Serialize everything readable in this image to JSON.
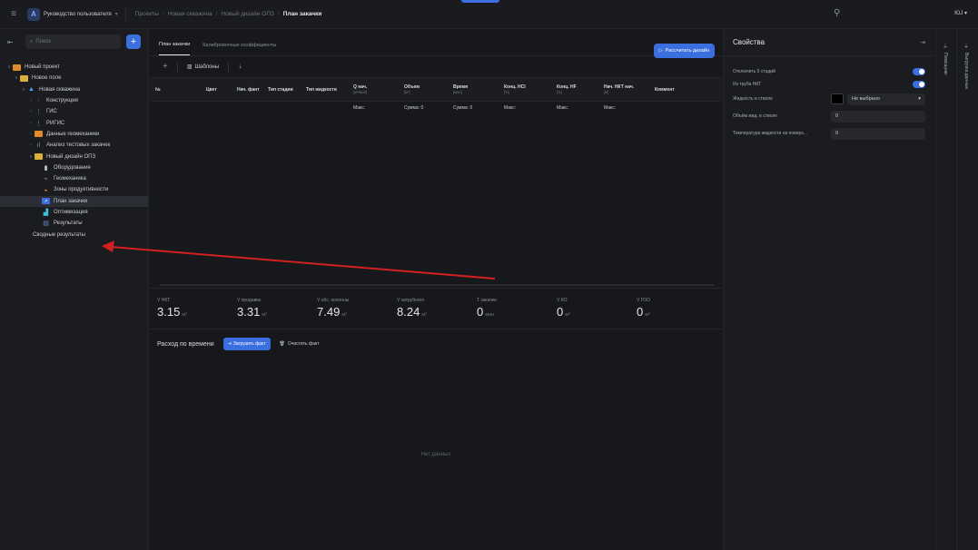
{
  "topbar": {
    "menu_icon": "menu-icon",
    "guide_logo": "A",
    "guide_label": "Руководство пользователя",
    "breadcrumbs": [
      "Проекты",
      "Новая скважина",
      "Новый дизайн ОПЗ",
      "План закачки"
    ],
    "user": "ЮJ"
  },
  "sidebar": {
    "search_placeholder": "Поиск",
    "tree": [
      {
        "label": "Новый проект",
        "level": 0,
        "icon": "project-icon"
      },
      {
        "label": "Новое поле",
        "level": 1,
        "icon": "folder-icon"
      },
      {
        "label": "Новая скважина",
        "level": 2,
        "icon": "well-icon"
      },
      {
        "label": "Конструкция",
        "level": 3,
        "icon": "construction-icon"
      },
      {
        "label": "ГИС",
        "level": 3,
        "icon": "gis-icon"
      },
      {
        "label": "РИГИС",
        "level": 3,
        "icon": "rigis-icon"
      },
      {
        "label": "Данные геомеханики",
        "level": 3,
        "icon": "geomech-folder-icon"
      },
      {
        "label": "Анализ тестовых закачек",
        "level": 3,
        "icon": "analysis-icon"
      },
      {
        "label": "Новый дизайн ОПЗ",
        "level": 3,
        "icon": "design-icon"
      },
      {
        "label": "Оборудование",
        "level": 4,
        "icon": "equipment-icon"
      },
      {
        "label": "Геомеханика",
        "level": 4,
        "icon": "geomechanics-icon"
      },
      {
        "label": "Зоны продуктивности",
        "level": 4,
        "icon": "zones-icon"
      },
      {
        "label": "План закачки",
        "level": 4,
        "icon": "plan-icon",
        "active": true
      },
      {
        "label": "Оптимизация",
        "level": 4,
        "icon": "optimization-icon"
      },
      {
        "label": "Результаты",
        "level": 4,
        "icon": "results-icon"
      },
      {
        "label": "Сводные результаты",
        "level": 3,
        "icon": ""
      }
    ]
  },
  "main": {
    "tabs": [
      "План закачки",
      "Калибровочные коэффициенты"
    ],
    "calc_button": "Рассчитать дизайн",
    "toolbar": {
      "templates": "Шаблоны"
    },
    "columns": [
      {
        "label": "№",
        "unit": ""
      },
      {
        "label": "Цвет",
        "unit": ""
      },
      {
        "label": "Нач. фант",
        "unit": ""
      },
      {
        "label": "Тип стадии",
        "unit": ""
      },
      {
        "label": "Тип жидкости",
        "unit": ""
      },
      {
        "label": "Q нач.",
        "unit": "[м³/мин]"
      },
      {
        "label": "Объем",
        "unit": "[м³]"
      },
      {
        "label": "Время",
        "unit": "[мин]"
      },
      {
        "label": "Конц. HCl",
        "unit": "[%]"
      },
      {
        "label": "Конц. HF",
        "unit": "[%]"
      },
      {
        "label": "Нач. НКТ нач.",
        "unit": "[м]"
      },
      {
        "label": "Коммент",
        "unit": ""
      }
    ],
    "summary": [
      "",
      "",
      "",
      "",
      "",
      "Макс:",
      "Сумма: 0",
      "Сумма: 0",
      "Макс:",
      "Макс:",
      "Макс:",
      ""
    ],
    "stats": [
      {
        "label": "V НКТ",
        "value": "3.15",
        "unit": "м³"
      },
      {
        "label": "V продавки",
        "value": "3.31",
        "unit": "м³"
      },
      {
        "label": "V обс. колонны",
        "value": "7.49",
        "unit": "м³"
      },
      {
        "label": "V затрубного",
        "value": "8.24",
        "unit": "м³"
      },
      {
        "label": "T закачки",
        "value": "0",
        "unit": "мин"
      },
      {
        "label": "V КО",
        "value": "0",
        "unit": "м³"
      },
      {
        "label": "V ГОО",
        "value": "0",
        "unit": "м³"
      }
    ],
    "flow": {
      "title": "Расход по времени",
      "load_button": "Загрузить факт",
      "clear_button": "Очистить факт",
      "no_data": "Нет данных"
    }
  },
  "properties": {
    "title": "Свойства",
    "toggles": [
      {
        "label": "Отключить 0 стадий",
        "on": true
      },
      {
        "label": "Из труба НКТ",
        "on": true
      }
    ],
    "fluid_label": "Жидкость в стволе",
    "fluid_value": "Не выбрано",
    "volume_label": "Объём жид. в стволе",
    "volume_value": "0",
    "temp_label": "Температура жидкости на поверх...",
    "temp_value": "0"
  },
  "rails": {
    "rail1_label": "Помощник",
    "rail2_label": "Выгрузка данных"
  },
  "colors": {
    "accent": "#3b6fe0",
    "arrow": "#d21f1f",
    "bg": "#17181c"
  }
}
